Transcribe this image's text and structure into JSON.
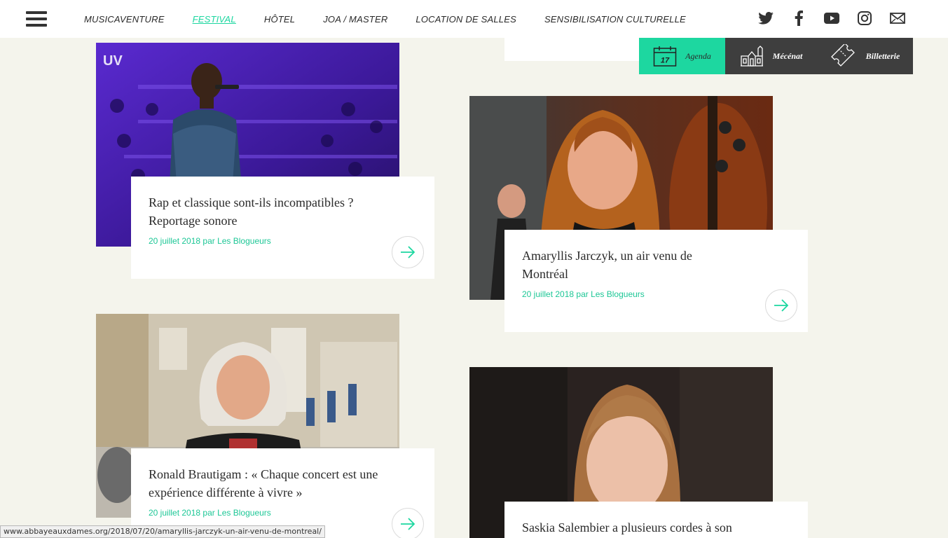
{
  "nav": {
    "items": [
      "MUSICAVENTURE",
      "FESTIVAL",
      "HÔTEL",
      "JOA / MASTER",
      "LOCATION DE SALLES",
      "SENSIBILISATION CULTURELLE"
    ],
    "active": "FESTIVAL"
  },
  "socials": [
    "twitter-icon",
    "facebook-icon",
    "youtube-icon",
    "instagram-icon",
    "mail-icon"
  ],
  "action_tabs": {
    "agenda": {
      "label": "Agenda",
      "day": "17"
    },
    "mecenat": {
      "label": "Mécénat"
    },
    "billetterie": {
      "label": "Billetterie"
    }
  },
  "articles": [
    {
      "title": "Rap et classique sont-ils incompatibles ? Reportage sonore",
      "meta": "20 juillet 2018 par Les Blogueurs"
    },
    {
      "title": "Amaryllis Jarczyk, un air venu de Montréal",
      "meta": "20 juillet 2018 par Les Blogueurs"
    },
    {
      "title": "Ronald Brautigam : « Chaque concert est une expérience différente à vivre »",
      "meta": "20 juillet 2018 par Les Blogueurs"
    },
    {
      "title": "Saskia Salembier a plusieurs cordes à son",
      "meta": ""
    }
  ],
  "image_text": {
    "stage_logo": "UV"
  },
  "colors": {
    "accent": "#1dd7a0",
    "dark": "#3e3e3e",
    "background": "#f4f4ec"
  },
  "status_url": "www.abbayeauxdames.org/2018/07/20/amaryllis-jarczyk-un-air-venu-de-montreal/"
}
